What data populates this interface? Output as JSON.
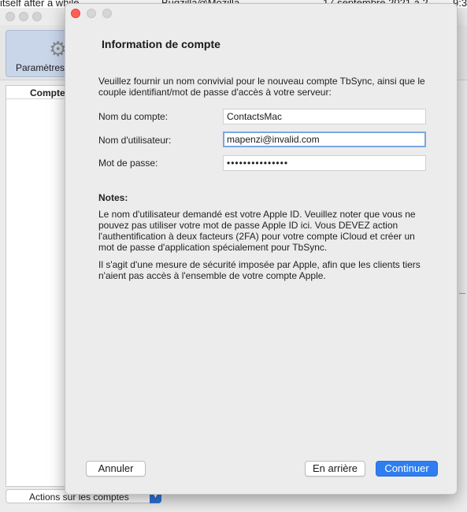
{
  "background": {
    "strip_texts": [
      "itself after a while",
      "Bugzilla@Mozilla",
      "17 septembre 2021 à 2",
      "9:3"
    ]
  },
  "back_window": {
    "toolbar_pref_label": "Paramètres",
    "list_header": "Compte",
    "actions_label": "Actions sur les comptes"
  },
  "dialog": {
    "title": "Information de compte",
    "intro": "Veuillez fournir un nom convivial pour le nouveau compte TbSync, ainsi que le couple identifiant/mot de passe d'accès à votre serveur:",
    "fields": {
      "account_name": {
        "label": "Nom du compte:",
        "value": "ContactsMac"
      },
      "username": {
        "label": "Nom d'utilisateur:",
        "value": "mapenzi@invalid.com"
      },
      "password": {
        "label": "Mot de passe:",
        "value": "•••••••••••••••"
      }
    },
    "notes_title": "Notes:",
    "notes_p1": "Le nom d'utilisateur demandé est votre Apple ID. Veuillez noter que vous ne pouvez pas utiliser votre mot de passe Apple ID ici. Vous DEVEZ action l'authentification à deux facteurs (2FA) pour votre compte iCloud et créer un mot de passe d'application spécialement pour TbSync.",
    "notes_p2": "Il s'agit d'une mesure de sécurité imposée par Apple, afin que les clients tiers n'aient pas accès à l'ensemble de votre compte Apple.",
    "buttons": {
      "cancel": "Annuler",
      "back": "En arrière",
      "continue": "Continuer"
    }
  },
  "colors": {
    "accent": "#2f7ef0",
    "close_dot": "#fe5f57",
    "focus_ring": "#7aa7e0"
  }
}
